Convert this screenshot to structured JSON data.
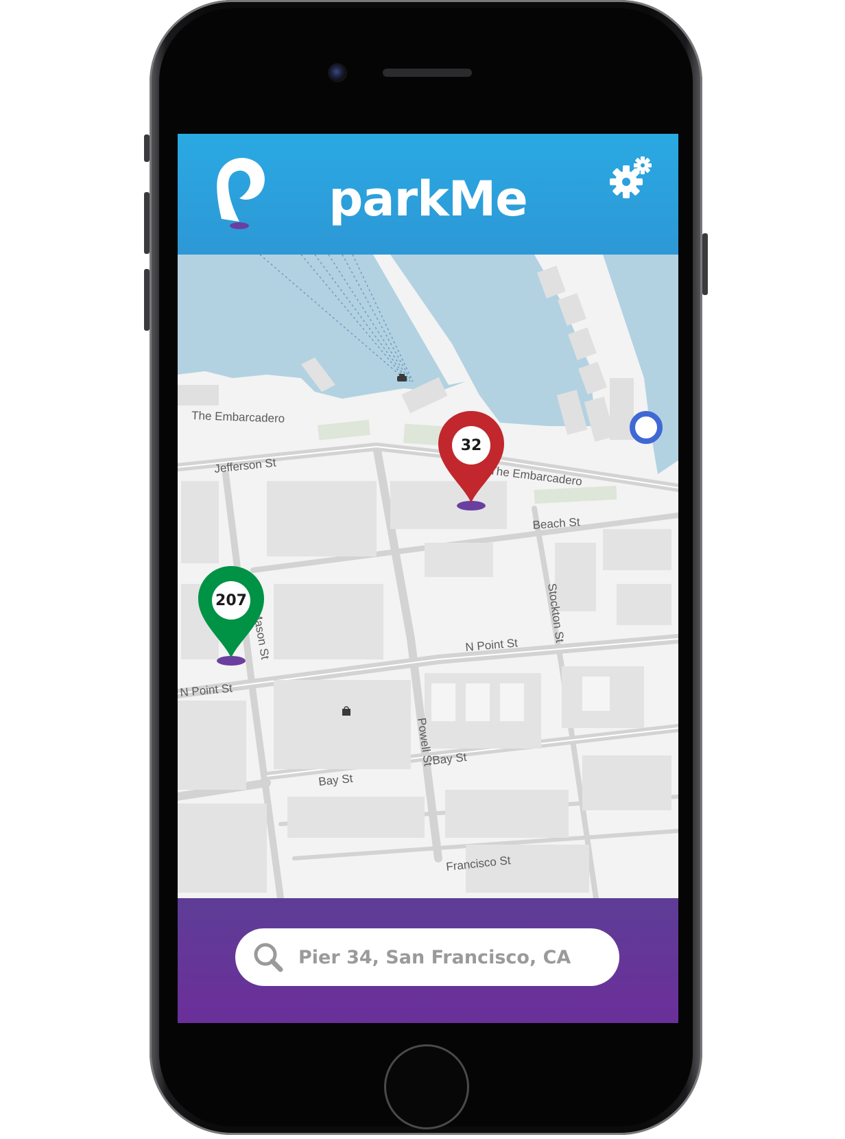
{
  "app": {
    "title": "parkMe",
    "logo_icon": "parkme-pin-logo-icon",
    "settings_icon": "gears-icon"
  },
  "colors": {
    "header": "#2aa9e2",
    "footer": "#6238a0",
    "pin_red": "#c1272d",
    "pin_green": "#009245",
    "pin_shadow": "#6a3fa0",
    "location_dot": "#3f6fd1"
  },
  "map": {
    "street_labels": [
      "The Embarcadero",
      "Jefferson St",
      "The Embarcadero",
      "Beach St",
      "Stockton St",
      "N Point St",
      "Mason St",
      "N Point St",
      "Powell St",
      "Bay St",
      "Bay St",
      "Francisco St"
    ],
    "pins": [
      {
        "name": "parking-pin-red",
        "count": "32",
        "color": "#c1272d"
      },
      {
        "name": "parking-pin-green",
        "count": "207",
        "color": "#009245"
      }
    ],
    "poi_icons": [
      "ferry-icon",
      "shopping-bag-icon"
    ],
    "current_location_icon": "current-location-icon"
  },
  "search": {
    "icon": "search-icon",
    "value": "Pier 34, San Francisco, CA"
  }
}
